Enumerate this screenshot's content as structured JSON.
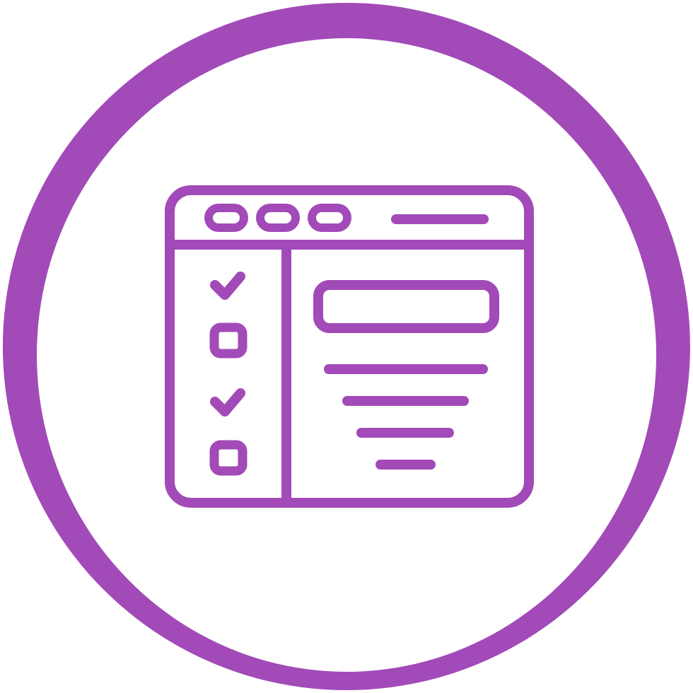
{
  "icon": {
    "name": "browser-checklist-icon",
    "accent_color": "#a24ab8",
    "background_color": "#ffffff",
    "checklist": [
      {
        "state": "checked"
      },
      {
        "state": "unchecked"
      },
      {
        "state": "checked"
      },
      {
        "state": "unchecked"
      }
    ],
    "window_dots": 3,
    "content_lines": 4
  }
}
